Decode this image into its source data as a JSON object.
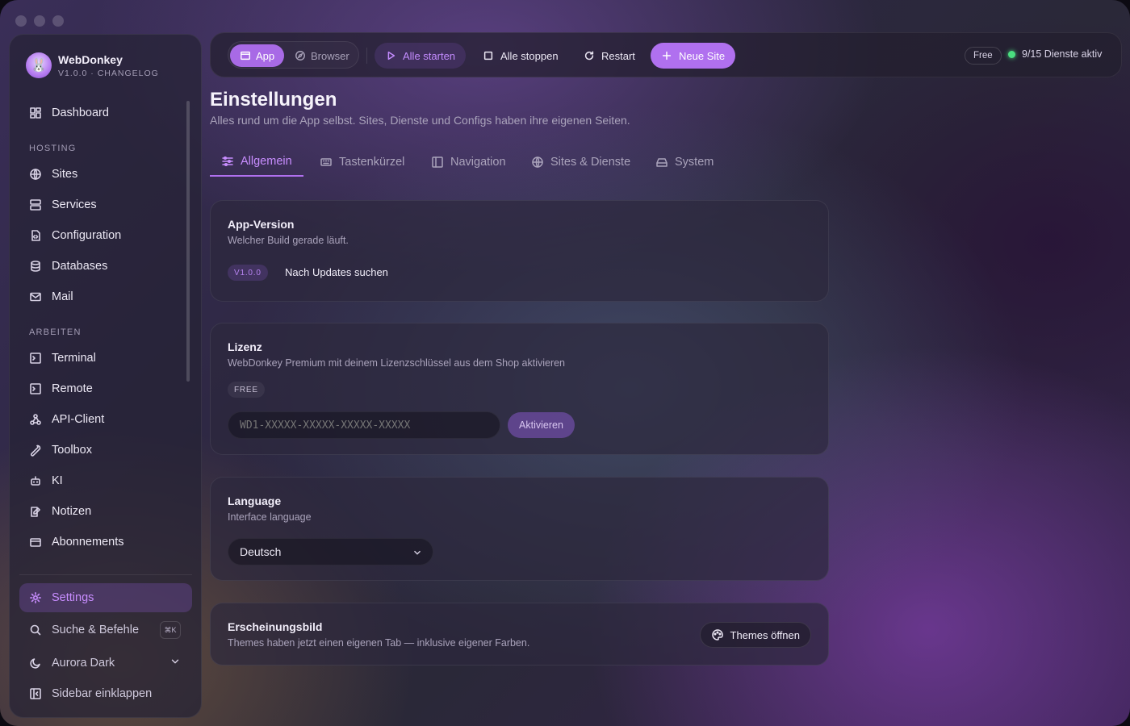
{
  "brand": {
    "name": "WebDonkey",
    "version": "V1.0.0 · CHANGELOG"
  },
  "sidebar": {
    "dashboard": "Dashboard",
    "section_hosting": "HOSTING",
    "hosting": [
      "Sites",
      "Services",
      "Configuration",
      "Databases",
      "Mail"
    ],
    "section_work": "ARBEITEN",
    "work": [
      "Terminal",
      "Remote",
      "API-Client",
      "Toolbox",
      "KI",
      "Notizen",
      "Abonnements"
    ],
    "settings": "Settings",
    "search": "Suche & Befehle",
    "search_kbd": "⌘K",
    "theme": "Aurora Dark",
    "collapse": "Sidebar einklappen"
  },
  "topbar": {
    "app": "App",
    "browser": "Browser",
    "start_all": "Alle starten",
    "stop_all": "Alle stoppen",
    "restart": "Restart",
    "new_site": "Neue Site",
    "plan": "Free",
    "services_status": "9/15 Dienste aktiv"
  },
  "page": {
    "title": "Einstellungen",
    "subtitle": "Alles rund um die App selbst. Sites, Dienste und Configs haben ihre eigenen Seiten."
  },
  "tabs": [
    "Allgemein",
    "Tastenkürzel",
    "Navigation",
    "Sites & Dienste",
    "System"
  ],
  "cards": {
    "version": {
      "title": "App-Version",
      "desc": "Welcher Build gerade läuft.",
      "badge": "V1.0.0",
      "action": "Nach Updates suchen"
    },
    "license": {
      "title": "Lizenz",
      "desc": "WebDonkey Premium mit deinem Lizenzschlüssel aus dem Shop aktivieren",
      "badge": "FREE",
      "placeholder": "WD1-XXXXX-XXXXX-XXXXX-XXXXX",
      "button": "Aktivieren"
    },
    "language": {
      "title": "Language",
      "desc": "Interface language",
      "selected": "Deutsch"
    },
    "appearance": {
      "title": "Erscheinungsbild",
      "desc": "Themes haben jetzt einen eigenen Tab — inklusive eigener Farben.",
      "button": "Themes öffnen"
    }
  },
  "colors": {
    "accent": "#b070ef",
    "accent_text": "#c88dff",
    "status_green": "#4ade80"
  }
}
